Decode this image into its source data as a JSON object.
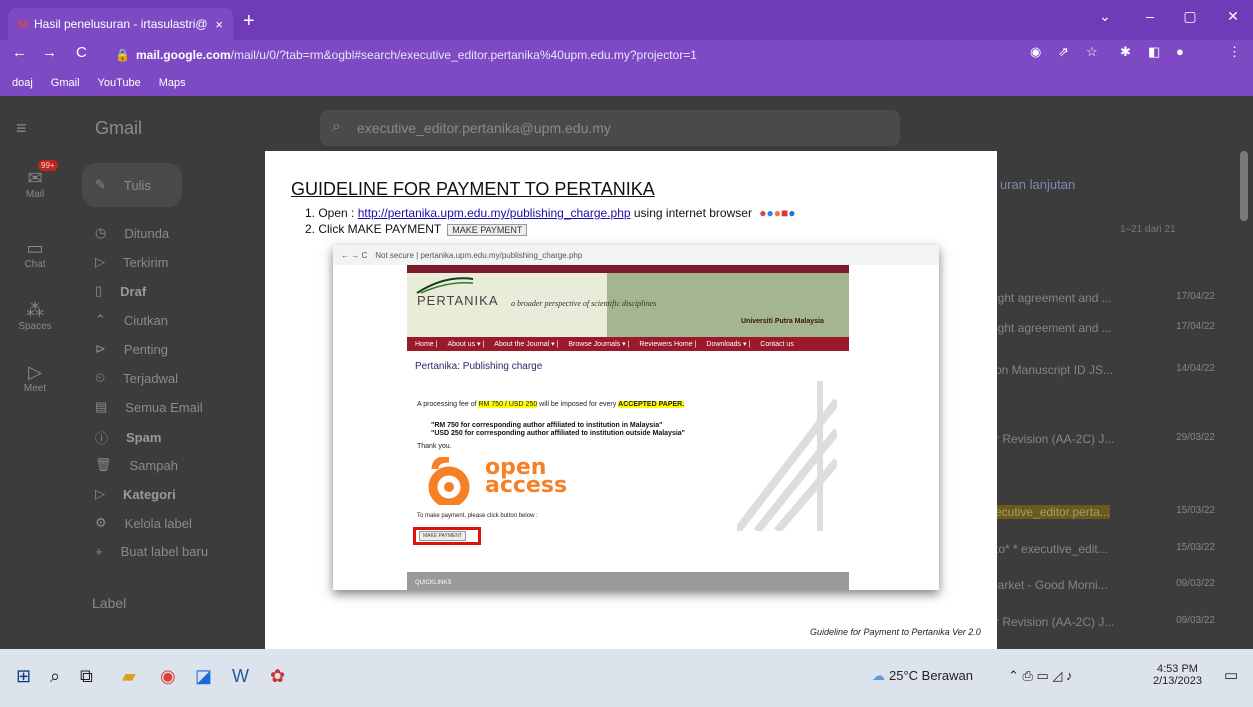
{
  "browser": {
    "tab_title": "Hasil penelusuran - irtasulastri@",
    "tab_close": "×",
    "new_tab": "+",
    "url_host": "mail.google.com",
    "url_path": "/mail/u/0/?tab=rm&ogbl#search/executive_editor.pertanika%40upm.edu.my?projector=1",
    "bookmarks": [
      "doaj",
      "Gmail",
      "YouTube",
      "Maps"
    ],
    "controls": {
      "minimize": "–",
      "maximize": "▢",
      "close": "✕",
      "menu": "⌄"
    }
  },
  "gmail": {
    "logo": "Gmail",
    "search_value": "executive_editor.pertanika@upm.edu.my",
    "rail": [
      {
        "label": "Mail",
        "badge": "99+"
      },
      {
        "label": "Chat"
      },
      {
        "label": "Spaces"
      },
      {
        "label": "Meet"
      }
    ],
    "compose": "Tulis",
    "nav": [
      "Ditunda",
      "Terkirim",
      "Draf",
      "Ciutkan",
      "Penting",
      "Terjadwal",
      "Semua Email",
      "Spam",
      "Sampah",
      "Kategori",
      "Kelola label",
      "Buat label baru"
    ],
    "labels_heading": "Label",
    "advanced": "uran lanjutan",
    "pager": "1–21 dari 21",
    "rows": [
      {
        "text": "ight agreement and ...",
        "date": "17/04/22"
      },
      {
        "text": "ight agreement and ...",
        "date": "17/04/22"
      },
      {
        "text": "on Manuscript ID JS...",
        "date": "14/04/22"
      },
      {
        "text": "r Revision (AA-2C) J...",
        "date": "29/03/22"
      },
      {
        "text": "ecutive_editor.perta...",
        "date": "15/03/22"
      },
      {
        "text": "to* * executive_edit...",
        "date": "15/03/22"
      },
      {
        "text": "larket - Good Morni...",
        "date": "09/03/22"
      },
      {
        "text": "r Revision (AA-2C) J...",
        "date": "09/03/22"
      }
    ]
  },
  "doc": {
    "title": "GUIDELINE FOR PAYMENT TO PERTANIKA",
    "step1_prefix": "1.  Open : ",
    "step1_link": "http://pertanika.upm.edu.my/publishing_charge.php",
    "step1_suffix": " using internet browser",
    "step2": "2.  Click MAKE PAYMENT",
    "step2_button": "MAKE PAYMENT",
    "caption": "Guideline for Payment to Pertanika Ver 2.0",
    "shot": {
      "address": "Not secure | pertanika.upm.edu.my/publishing_charge.php",
      "logo": "PERTANIKA",
      "tagline": "a broader perspective of scientific disciplines",
      "university": "Universiti Putra Malaysia",
      "nav": [
        "Home |",
        "About us ▾ |",
        "About the Journal ▾ |",
        "Browse Journals ▾ |",
        "Reviewers Home |",
        "Downloads ▾ |",
        "Contact us"
      ],
      "page_title": "Pertanika: Publishing charge",
      "fee_prefix": "A processing fee of ",
      "fee_amount": "RM 750 / USD 250",
      "fee_mid": " will be imposed for every ",
      "fee_accepted": "ACCEPTED PAPER.",
      "note1": "\"RM 750 for corresponding author affiliated to institution in Malaysia\"",
      "note2": "\"USD 250 for corresponding author affiliated to institution outside Malaysia\"",
      "thanks": "Thank you.",
      "oa_line1": "open",
      "oa_line2": "access",
      "to_make": "To make payment, please click button below :",
      "make_button": "MAKE PAYMENT",
      "quicklinks": "QUICKLINKS"
    }
  },
  "taskbar": {
    "weather": "25°C Berawan",
    "time": "4:53 PM",
    "date": "2/13/2023"
  }
}
